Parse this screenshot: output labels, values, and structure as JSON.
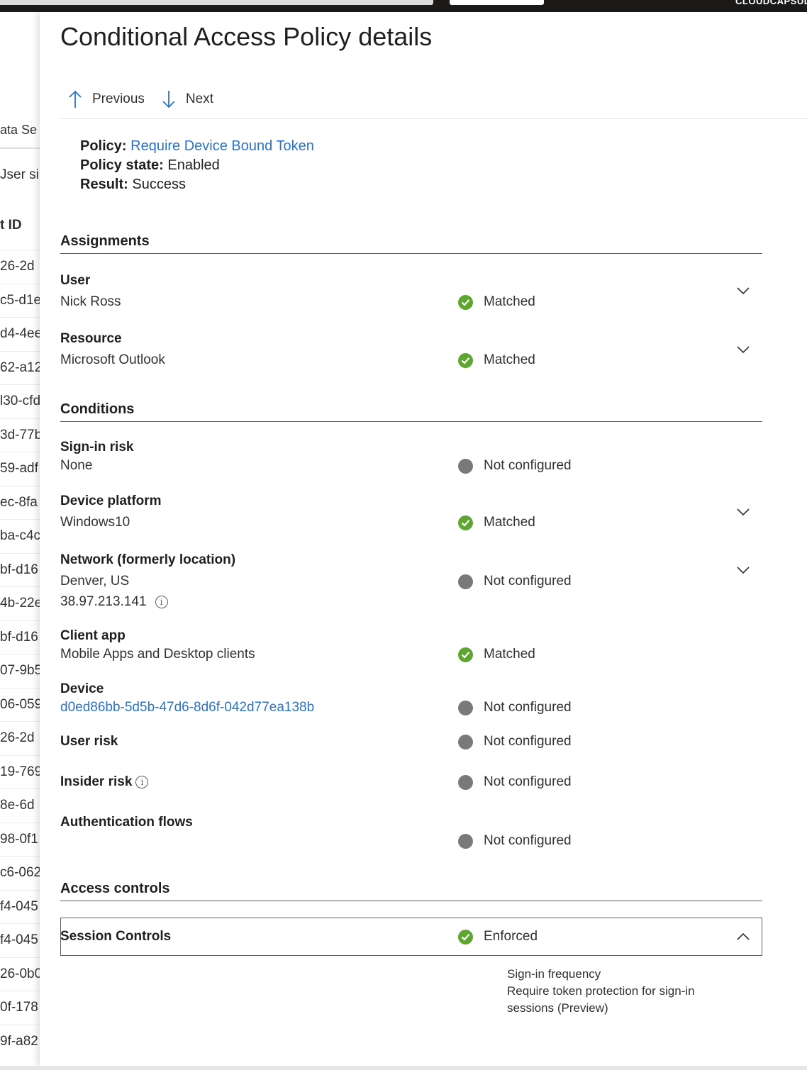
{
  "topbar": {
    "tenant": "CLOUDCAPSUL"
  },
  "background": {
    "tab": "ata Se",
    "sub": "Jser si",
    "column": "t ID",
    "rows": [
      "26-2d",
      "c5-d1e",
      "d4-4ee",
      "62-a12",
      "l30-cfd",
      "3d-77b",
      "59-adf",
      "ec-8fa",
      "ba-c4c",
      "bf-d16",
      "4b-22e",
      "bf-d16",
      "07-9b5",
      "06-059",
      "26-2d",
      "19-769",
      "8e-6d",
      "98-0f1",
      "c6-062",
      "f4-045",
      "f4-045",
      "26-0b0",
      "0f-178",
      "9f-a82"
    ]
  },
  "panel": {
    "title": "Conditional Access Policy details",
    "nav": {
      "previous": "Previous",
      "next": "Next"
    },
    "summary": {
      "policy_label": "Policy:",
      "policy_value": "Require Device Bound Token",
      "state_label": "Policy state:",
      "state_value": "Enabled",
      "result_label": "Result:",
      "result_value": "Success"
    },
    "sections": {
      "assignments": "Assignments",
      "conditions": "Conditions",
      "access_controls": "Access controls"
    },
    "assignments": {
      "user": {
        "label": "User",
        "value": "Nick Ross",
        "status": "Matched"
      },
      "resource": {
        "label": "Resource",
        "value": "Microsoft Outlook",
        "status": "Matched"
      }
    },
    "conditions": {
      "signin_risk": {
        "label": "Sign-in risk",
        "value": "None",
        "status": "Not configured"
      },
      "device_platform": {
        "label": "Device platform",
        "value": "Windows10",
        "status": "Matched"
      },
      "network": {
        "label": "Network (formerly location)",
        "value": "Denver, US",
        "ip": "38.97.213.141",
        "status": "Not configured"
      },
      "client_app": {
        "label": "Client app",
        "value": "Mobile Apps and Desktop clients",
        "status": "Matched"
      },
      "device": {
        "label": "Device",
        "value": "d0ed86bb-5d5b-47d6-8d6f-042d77ea138b",
        "status": "Not configured"
      },
      "user_risk": {
        "label": "User risk",
        "status": "Not configured"
      },
      "insider_risk": {
        "label": "Insider risk",
        "status": "Not configured"
      },
      "auth_flows": {
        "label": "Authentication flows",
        "status": "Not configured"
      }
    },
    "access_controls": {
      "session": {
        "label": "Session Controls",
        "status": "Enforced",
        "details": [
          "Sign-in frequency",
          "Require token protection for sign-in sessions (Preview)"
        ]
      }
    },
    "colors": {
      "matched": "#5ea631",
      "not_configured": "#7a7978",
      "link": "#2b73c9"
    }
  }
}
